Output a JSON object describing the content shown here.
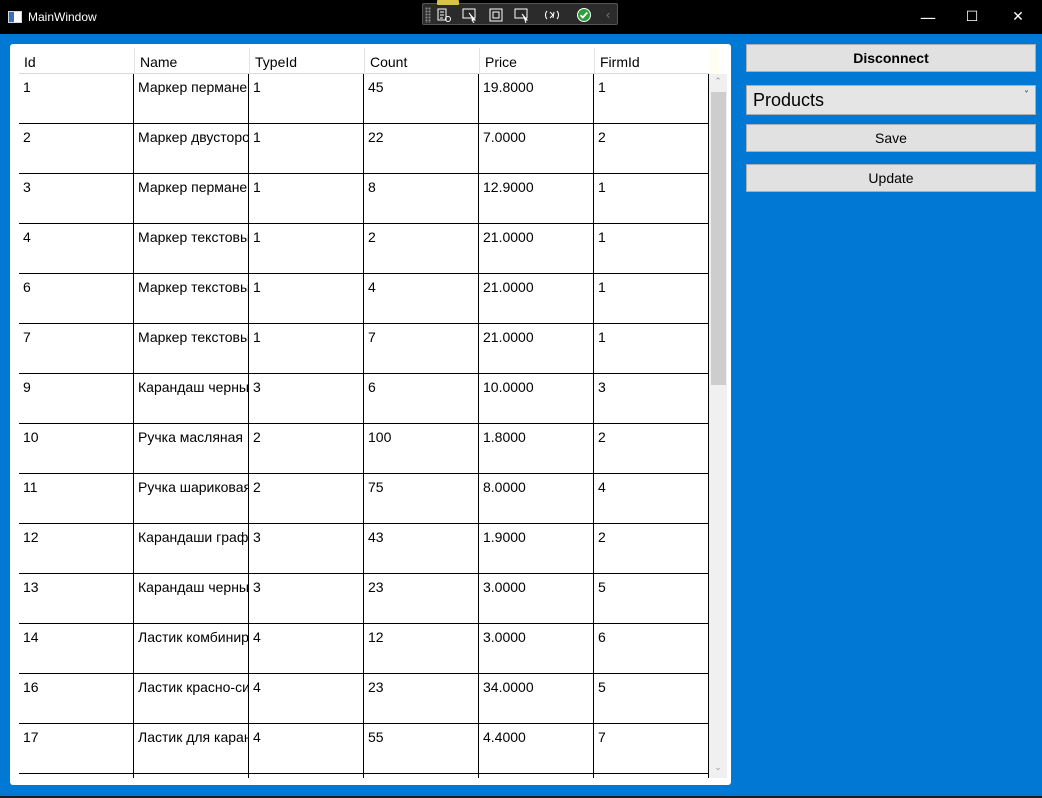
{
  "window": {
    "title": "MainWindow",
    "minimize_glyph": "—",
    "maximize_glyph": "☐",
    "close_glyph": "✕"
  },
  "debug_toolbar": {
    "icons": [
      "live-visual-tree-icon",
      "select-element-icon",
      "display-adorners-icon",
      "track-focus-icon",
      "hot-reload-icon",
      "binding-check-icon",
      "collapse-icon"
    ]
  },
  "grid": {
    "columns": [
      "Id",
      "Name",
      "TypeId",
      "Count",
      "Price",
      "FirmId"
    ],
    "rows": [
      [
        "1",
        "Маркер перманентный",
        "1",
        "45",
        "19.8000",
        "1"
      ],
      [
        "2",
        "Маркер двусторонний",
        "1",
        "22",
        "7.0000",
        "2"
      ],
      [
        "3",
        "Маркер перманентный",
        "1",
        "8",
        "12.9000",
        "1"
      ],
      [
        "4",
        "Маркер текстовый",
        "1",
        "2",
        "21.0000",
        "1"
      ],
      [
        "6",
        "Маркер текстовый",
        "1",
        "4",
        "21.0000",
        "1"
      ],
      [
        "7",
        "Маркер текстовый",
        "1",
        "7",
        "21.0000",
        "1"
      ],
      [
        "9",
        "Карандаш черный",
        "3",
        "6",
        "10.0000",
        "3"
      ],
      [
        "10",
        "Ручка масляная",
        "2",
        "100",
        "1.8000",
        "2"
      ],
      [
        "11",
        "Ручка шариковая",
        "2",
        "75",
        "8.0000",
        "4"
      ],
      [
        "12",
        "Карандаши графитные",
        "3",
        "43",
        "1.9000",
        "2"
      ],
      [
        "13",
        "Карандаш черный",
        "3",
        "23",
        "3.0000",
        "5"
      ],
      [
        "14",
        "Ластик комбинированный",
        "4",
        "12",
        "3.0000",
        "6"
      ],
      [
        "16",
        "Ластик красно-синий",
        "4",
        "23",
        "34.0000",
        "5"
      ],
      [
        "17",
        "Ластик для карандаша",
        "4",
        "55",
        "4.4000",
        "7"
      ],
      [
        "",
        "",
        "",
        "",
        "",
        ""
      ]
    ]
  },
  "controls": {
    "disconnect_label": "Disconnect",
    "table_select_value": "Products",
    "save_label": "Save",
    "update_label": "Update"
  },
  "colors": {
    "accent": "#0078d4",
    "titlebar": "#000000",
    "button_bg": "#e1e1e1"
  }
}
